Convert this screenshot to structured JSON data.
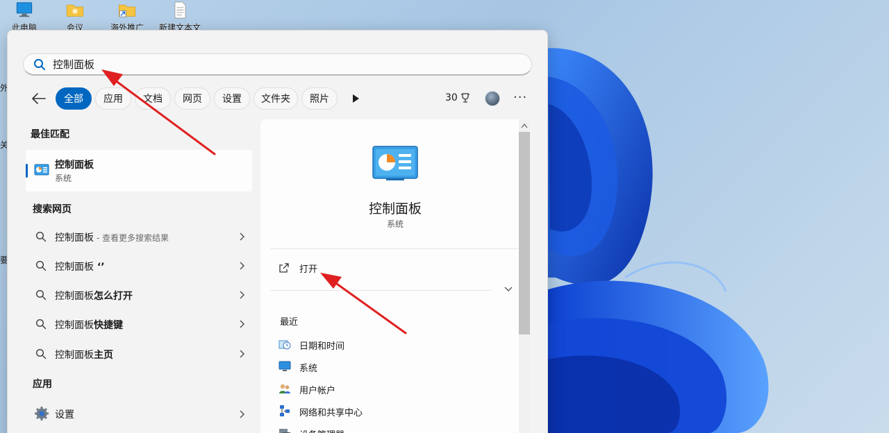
{
  "desktop": {
    "icons": [
      {
        "label": "此电脑",
        "icon": "computer-icon"
      },
      {
        "label": "会议",
        "icon": "folder-icon"
      },
      {
        "label": "海外推广",
        "icon": "folder-shortcut-icon"
      },
      {
        "label": "新建文本文",
        "icon": "text-file-icon"
      }
    ],
    "edge_texts": [
      "外",
      "关",
      "要"
    ]
  },
  "search": {
    "query": "控制面板",
    "icon": "search-icon"
  },
  "filters": {
    "items": [
      "全部",
      "应用",
      "文档",
      "网页",
      "设置",
      "文件夹",
      "照片"
    ],
    "active": "全部",
    "points": "30",
    "points_icon": "trophy-icon",
    "more": "···"
  },
  "best_match": {
    "section": "最佳匹配",
    "title": "控制面板",
    "subtitle": "系统"
  },
  "web_search": {
    "section": "搜索网页",
    "items": [
      {
        "text": "控制面板",
        "suffix": "",
        "hint": " - 查看更多搜索结果"
      },
      {
        "text": "控制面板",
        "suffix": " ‘’",
        "hint": ""
      },
      {
        "text": "控制面板",
        "suffix": "怎么打开",
        "hint": ""
      },
      {
        "text": "控制面板",
        "suffix": "快捷键",
        "hint": ""
      },
      {
        "text": "控制面板",
        "suffix": "主页",
        "hint": ""
      }
    ]
  },
  "apps": {
    "section": "应用",
    "items": [
      {
        "label": "设置",
        "icon": "gear-icon"
      }
    ]
  },
  "preview": {
    "title": "控制面板",
    "subtitle": "系统",
    "open_label": "打开",
    "recent_title": "最近",
    "recent_items": [
      {
        "label": "日期和时间",
        "icon": "clock-icon"
      },
      {
        "label": "系统",
        "icon": "monitor-icon"
      },
      {
        "label": "用户帐户",
        "icon": "users-icon"
      },
      {
        "label": "网络和共享中心",
        "icon": "network-icon"
      },
      {
        "label": "设备管理器",
        "icon": "device-manager-icon"
      }
    ]
  },
  "colors": {
    "accent": "#0067c0",
    "annotation": "#e02020",
    "wallpaper_blue": "#1653d8"
  }
}
